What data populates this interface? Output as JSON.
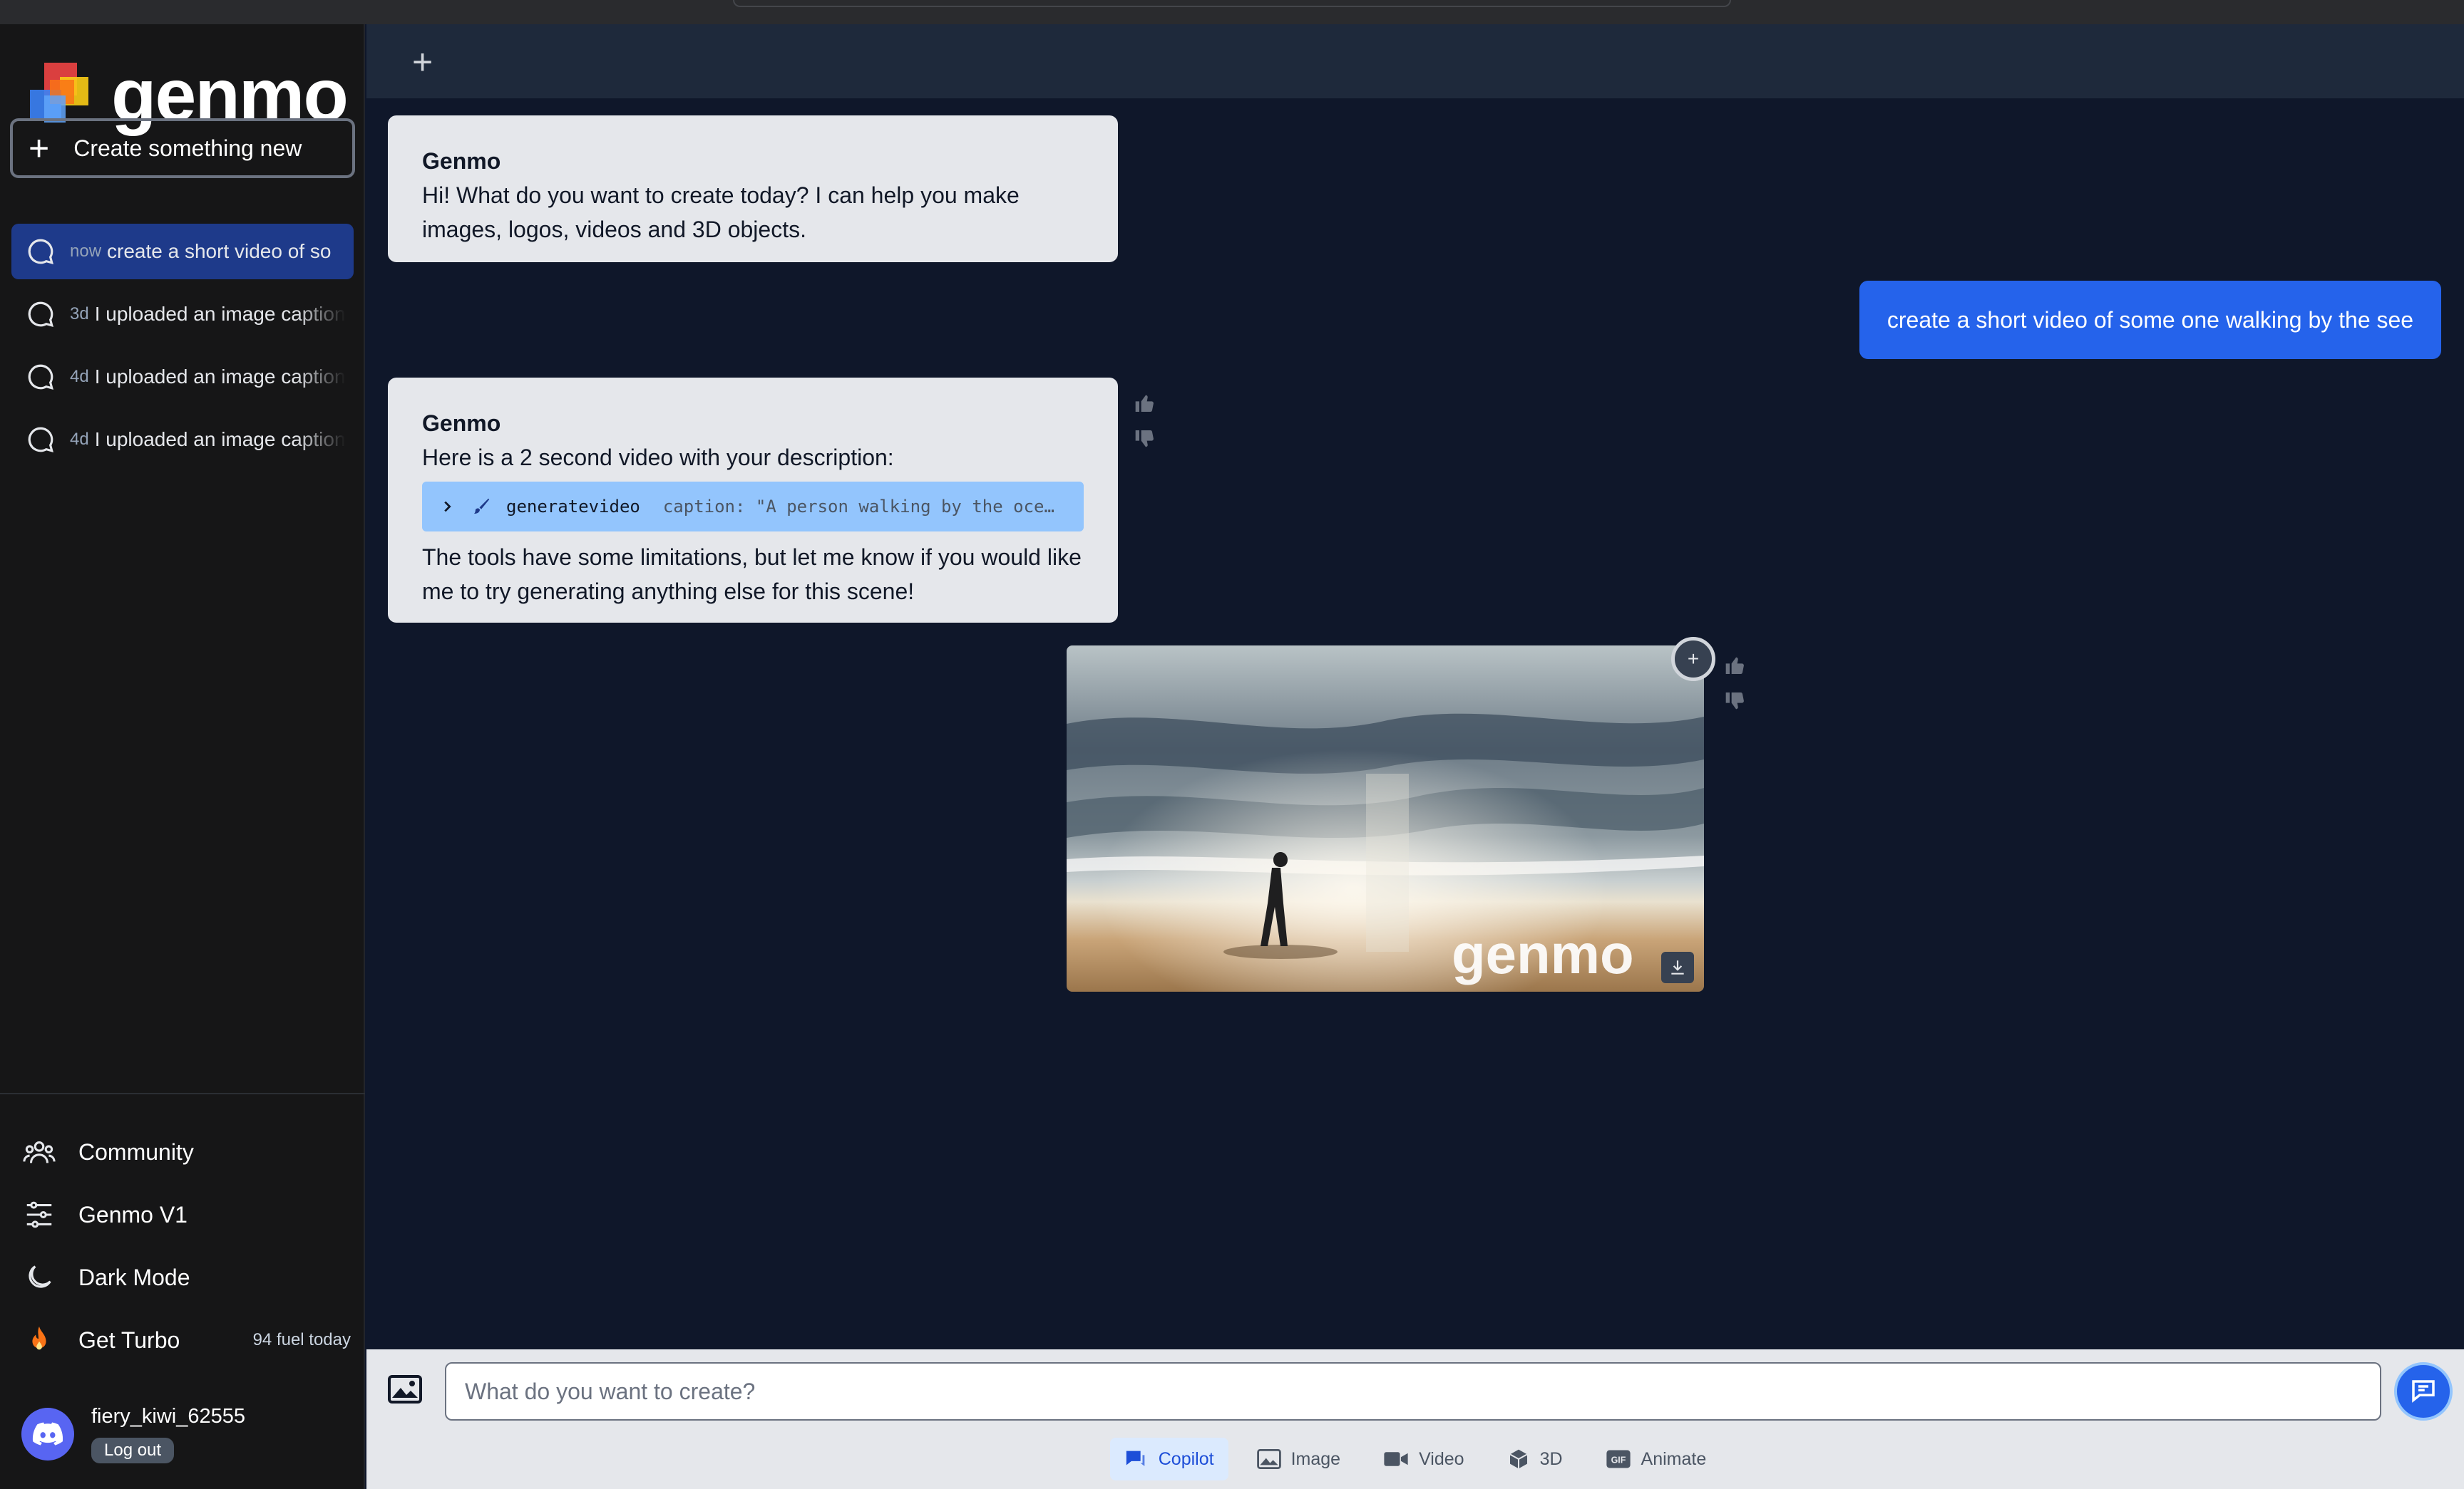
{
  "app": {
    "logo_text": "genmo"
  },
  "sidebar": {
    "new_button": "Create something new",
    "history": [
      {
        "ago": "now",
        "text": "create a short video of so",
        "active": true
      },
      {
        "ago": "3d",
        "text": "I uploaded an image caption",
        "active": false
      },
      {
        "ago": "4d",
        "text": "I uploaded an image caption",
        "active": false
      },
      {
        "ago": "4d",
        "text": "I uploaded an image caption",
        "active": false
      }
    ],
    "nav": {
      "community": "Community",
      "v1": "Genmo V1",
      "dark_mode": "Dark Mode",
      "turbo": "Get Turbo",
      "fuel": "94 fuel today"
    },
    "user": {
      "name": "fiery_kiwi_62555",
      "logout": "Log out"
    }
  },
  "chat": {
    "msg1": {
      "sender": "Genmo",
      "text": "Hi! What do you want to create today? I can help you make images, logos, videos and 3D objects."
    },
    "user_msg": "create a short video of some one walking by the see",
    "msg2": {
      "sender": "Genmo",
      "intro": "Here is a 2 second video with your description:",
      "tool_name": "generatevideo",
      "tool_caption": "caption: \"A person walking by the oce…",
      "outro": "The tools have some limitations, but let me know if you would like me to try generating anything else for this scene!"
    },
    "video_watermark": "genmo"
  },
  "composer": {
    "placeholder": "What do you want to create?",
    "modes": [
      "Copilot",
      "Image",
      "Video",
      "3D",
      "Animate"
    ],
    "active_mode": "Copilot"
  },
  "colors": {
    "accent": "#2563eb",
    "sidebar_bg": "#161617",
    "main_bg": "#0f172a"
  }
}
